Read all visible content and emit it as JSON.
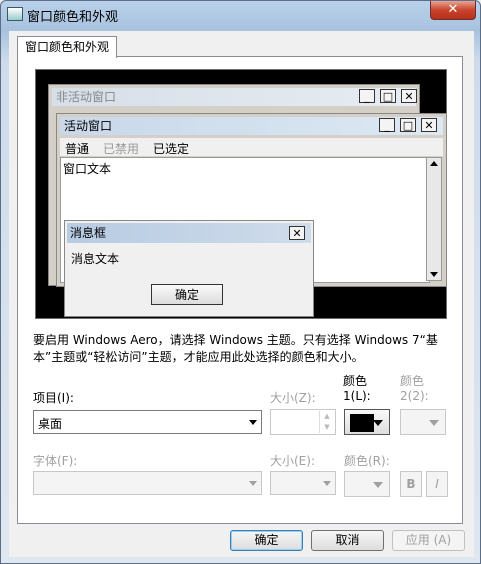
{
  "window": {
    "title": "窗口颜色和外观",
    "close_label": "✕"
  },
  "tab": {
    "label": "窗口颜色和外观"
  },
  "preview": {
    "inactive_title": "非活动窗口",
    "active_title": "活动窗口",
    "menu": {
      "normal": "普通",
      "disabled": "已禁用",
      "selected": "已选定"
    },
    "window_text": "窗口文本",
    "msgbox_title": "消息框",
    "msgbox_text": "消息文本",
    "msgbox_ok": "确定",
    "sys_min": "_",
    "sys_max": "□",
    "sys_close": "✕"
  },
  "info_text": "要启用 Windows Aero，请选择 Windows 主题。只有选择 Windows 7“基本”主题或“轻松访问”主题，才能应用此处选择的颜色和大小。",
  "item": {
    "label": "项目(I):",
    "value": "桌面"
  },
  "size1": {
    "label": "大小(Z):"
  },
  "color1": {
    "label_line1": "颜色",
    "label_line2": "1(L):",
    "value": "#000000"
  },
  "color2": {
    "label_line1": "颜色",
    "label_line2": "2(2):"
  },
  "font": {
    "label": "字体(F):"
  },
  "size2": {
    "label": "大小(E):"
  },
  "color3": {
    "label": "颜色(R):"
  },
  "bold_label": "B",
  "italic_label": "I",
  "buttons": {
    "ok": "确定",
    "cancel": "取消",
    "apply": "应用 (A)"
  }
}
